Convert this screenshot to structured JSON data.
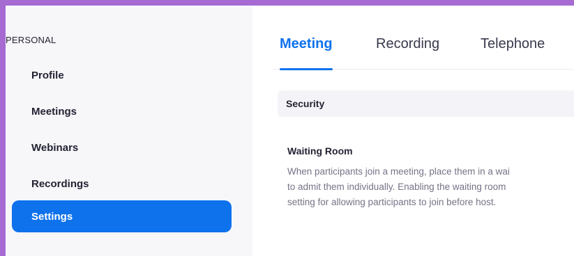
{
  "sidebar": {
    "section_label": "PERSONAL",
    "items": [
      {
        "label": "Profile",
        "active": false
      },
      {
        "label": "Meetings",
        "active": false
      },
      {
        "label": "Webinars",
        "active": false
      },
      {
        "label": "Recordings",
        "active": false
      },
      {
        "label": "Settings",
        "active": true
      }
    ]
  },
  "tabs": [
    {
      "label": "Meeting",
      "active": true
    },
    {
      "label": "Recording",
      "active": false
    },
    {
      "label": "Telephone",
      "active": false
    }
  ],
  "section": {
    "title": "Security"
  },
  "setting": {
    "title": "Waiting Room",
    "description_lines": [
      "When participants join a meeting, place them in a wai",
      "to admit them individually. Enabling the waiting room",
      "setting for allowing participants to join before host."
    ]
  },
  "colors": {
    "accent": "#0e72ed",
    "border_highlight": "#a66ad3",
    "sidebar_bg": "#f7f7fa"
  }
}
